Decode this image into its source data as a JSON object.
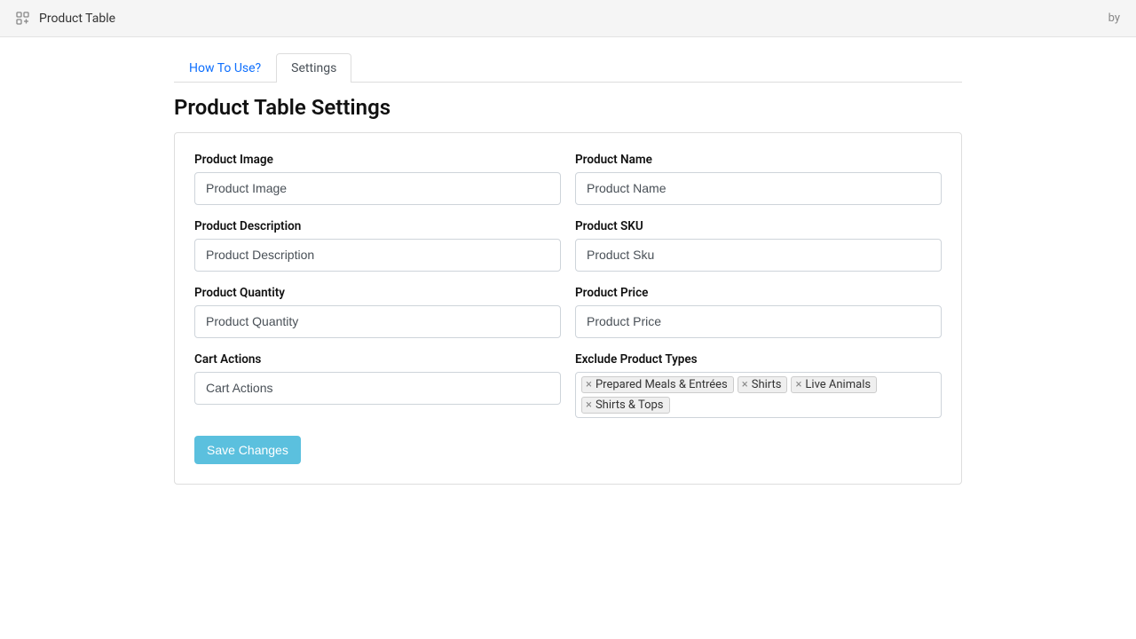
{
  "topbar": {
    "title": "Product Table",
    "byText": "by"
  },
  "tabs": {
    "howToUse": "How To Use?",
    "settings": "Settings"
  },
  "heading": "Product Table Settings",
  "form": {
    "productImage": {
      "label": "Product Image",
      "value": "Product Image"
    },
    "productName": {
      "label": "Product Name",
      "value": "Product Name"
    },
    "productDescription": {
      "label": "Product Description",
      "value": "Product Description"
    },
    "productSku": {
      "label": "Product SKU",
      "value": "Product Sku"
    },
    "productQuantity": {
      "label": "Product Quantity",
      "value": "Product Quantity"
    },
    "productPrice": {
      "label": "Product Price",
      "value": "Product Price"
    },
    "cartActions": {
      "label": "Cart Actions",
      "value": "Cart Actions"
    },
    "excludeTypes": {
      "label": "Exclude Product Types",
      "tags": [
        "Prepared Meals & Entrées",
        "Shirts",
        "Live Animals",
        "Shirts & Tops"
      ]
    }
  },
  "buttons": {
    "save": "Save Changes"
  }
}
